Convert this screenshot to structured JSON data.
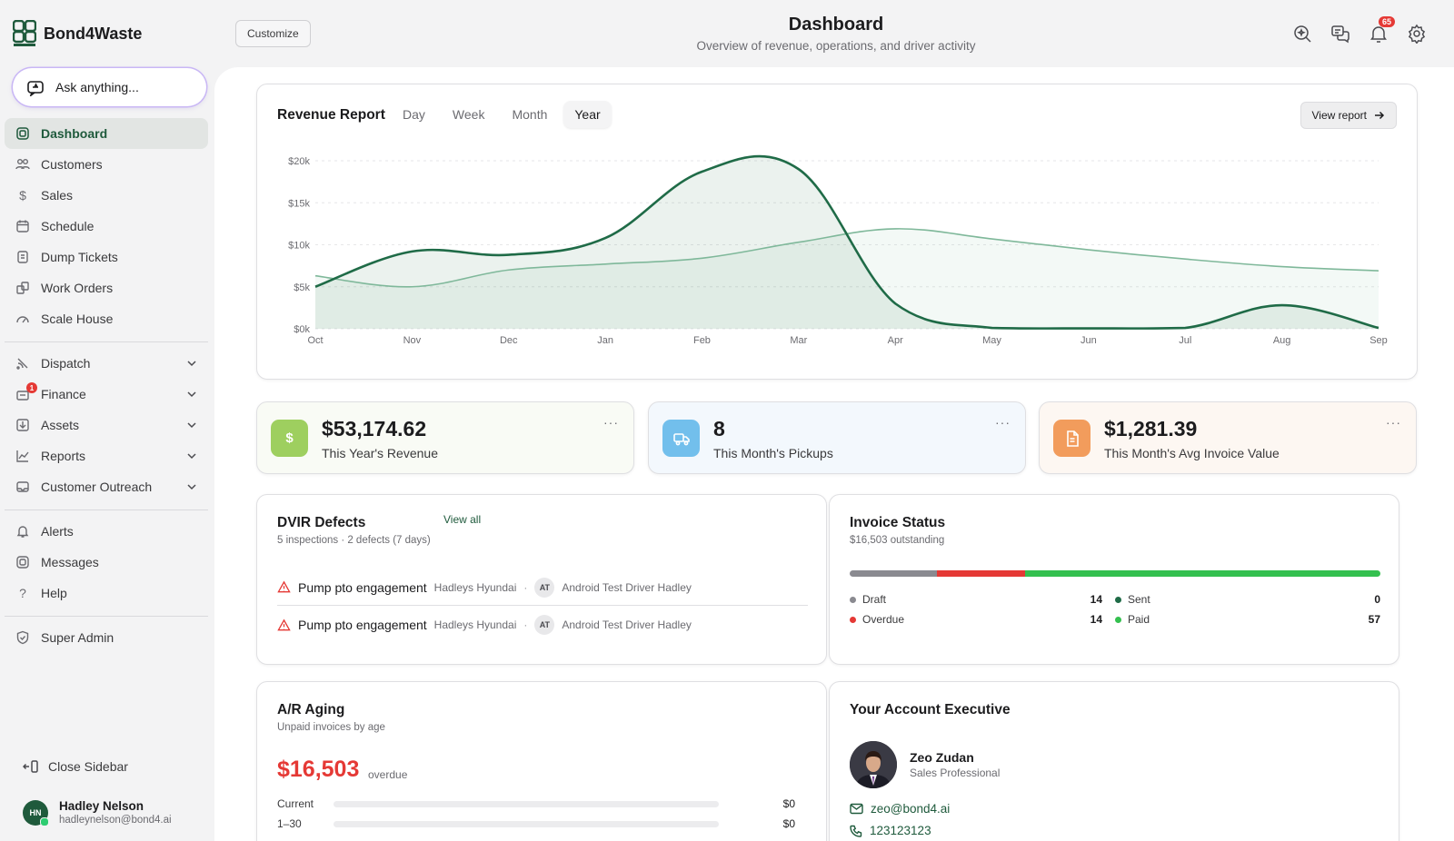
{
  "brand": {
    "name": "Bond4Waste"
  },
  "sidebar": {
    "ask_placeholder": "Ask anything...",
    "items": [
      {
        "label": "Dashboard",
        "icon": "dashboard-icon",
        "active": true
      },
      {
        "label": "Customers",
        "icon": "customers-icon"
      },
      {
        "label": "Sales",
        "icon": "dollar-icon"
      },
      {
        "label": "Schedule",
        "icon": "calendar-icon"
      },
      {
        "label": "Dump Tickets",
        "icon": "ticket-icon"
      },
      {
        "label": "Work Orders",
        "icon": "work-orders-icon"
      },
      {
        "label": "Scale House",
        "icon": "gauge-icon"
      }
    ],
    "groups": [
      {
        "label": "Dispatch",
        "icon": "dispatch-icon"
      },
      {
        "label": "Finance",
        "icon": "finance-icon",
        "badge": "1"
      },
      {
        "label": "Assets",
        "icon": "assets-icon"
      },
      {
        "label": "Reports",
        "icon": "reports-icon"
      },
      {
        "label": "Customer Outreach",
        "icon": "mail-icon"
      }
    ],
    "secondary": [
      {
        "label": "Alerts",
        "icon": "bell-icon"
      },
      {
        "label": "Messages",
        "icon": "message-icon"
      },
      {
        "label": "Help",
        "icon": "help-icon"
      }
    ],
    "admin": {
      "label": "Super Admin",
      "icon": "shield-icon"
    },
    "close_label": "Close Sidebar",
    "user": {
      "initials": "HN",
      "name": "Hadley Nelson",
      "email": "hadleynelson@bond4.ai"
    }
  },
  "header": {
    "customize_label": "Customize",
    "title": "Dashboard",
    "subtitle": "Overview of revenue, operations, and driver activity",
    "notification_count": "65"
  },
  "revenue": {
    "title": "Revenue Report",
    "tabs": [
      "Day",
      "Week",
      "Month",
      "Year"
    ],
    "active_tab": "Year",
    "view_report_label": "View report"
  },
  "chart_data": {
    "type": "area",
    "categories": [
      "Oct",
      "Nov",
      "Dec",
      "Jan",
      "Feb",
      "Mar",
      "Apr",
      "May",
      "Jun",
      "Jul",
      "Aug",
      "Sep"
    ],
    "y_ticks": [
      "$0k",
      "$5k",
      "$10k",
      "$15k",
      "$20k"
    ],
    "ylim": [
      0,
      20000
    ],
    "series": [
      {
        "values": [
          5000,
          9200,
          8800,
          10800,
          18700,
          19000,
          3000,
          100,
          50,
          100,
          2800,
          100
        ],
        "color": "#1f6b47"
      },
      {
        "values": [
          6300,
          5000,
          7000,
          7700,
          8400,
          10300,
          11900,
          10700,
          9400,
          8300,
          7400,
          6900
        ],
        "color": "#7fb89a"
      }
    ]
  },
  "stats": [
    {
      "value": "$53,174.62",
      "label": "This Year's Revenue",
      "icon": "dollar-icon"
    },
    {
      "value": "8",
      "label": "This Month's Pickups",
      "icon": "truck-icon"
    },
    {
      "value": "$1,281.39",
      "label": "This Month's Avg Invoice Value",
      "icon": "document-icon"
    }
  ],
  "dvir": {
    "title": "DVIR Defects",
    "subtitle": "5 inspections · 2 defects (7 days)",
    "view_all": "View all",
    "defects": [
      {
        "name": "Pump pto engagement",
        "vehicle": "Hadleys Hyundai",
        "driver_initials": "AT",
        "driver": "Android Test Driver Hadley"
      },
      {
        "name": "Pump pto engagement",
        "vehicle": "Hadleys Hyundai",
        "driver_initials": "AT",
        "driver": "Android Test Driver Hadley"
      }
    ]
  },
  "invoice": {
    "title": "Invoice Status",
    "subtitle": "$16,503 outstanding",
    "statuses": [
      {
        "label": "Draft",
        "count": "14",
        "color": "#8a8a90",
        "share": 0.165
      },
      {
        "label": "Sent",
        "count": "0",
        "color": "#1f6b47",
        "share": 0
      },
      {
        "label": "Overdue",
        "count": "14",
        "color": "#e53935",
        "share": 0.165
      },
      {
        "label": "Paid",
        "count": "57",
        "color": "#34c04f",
        "share": 0.67
      }
    ]
  },
  "ar": {
    "title": "A/R Aging",
    "subtitle": "Unpaid invoices by age",
    "amount": "$16,503",
    "overdue_label": "overdue",
    "rows": [
      {
        "label": "Current",
        "amount": "$0"
      },
      {
        "label": "1–30",
        "amount": "$0"
      }
    ]
  },
  "exec": {
    "title": "Your Account Executive",
    "name": "Zeo Zudan",
    "role": "Sales Professional",
    "email": "zeo@bond4.ai",
    "phone": "123123123"
  }
}
